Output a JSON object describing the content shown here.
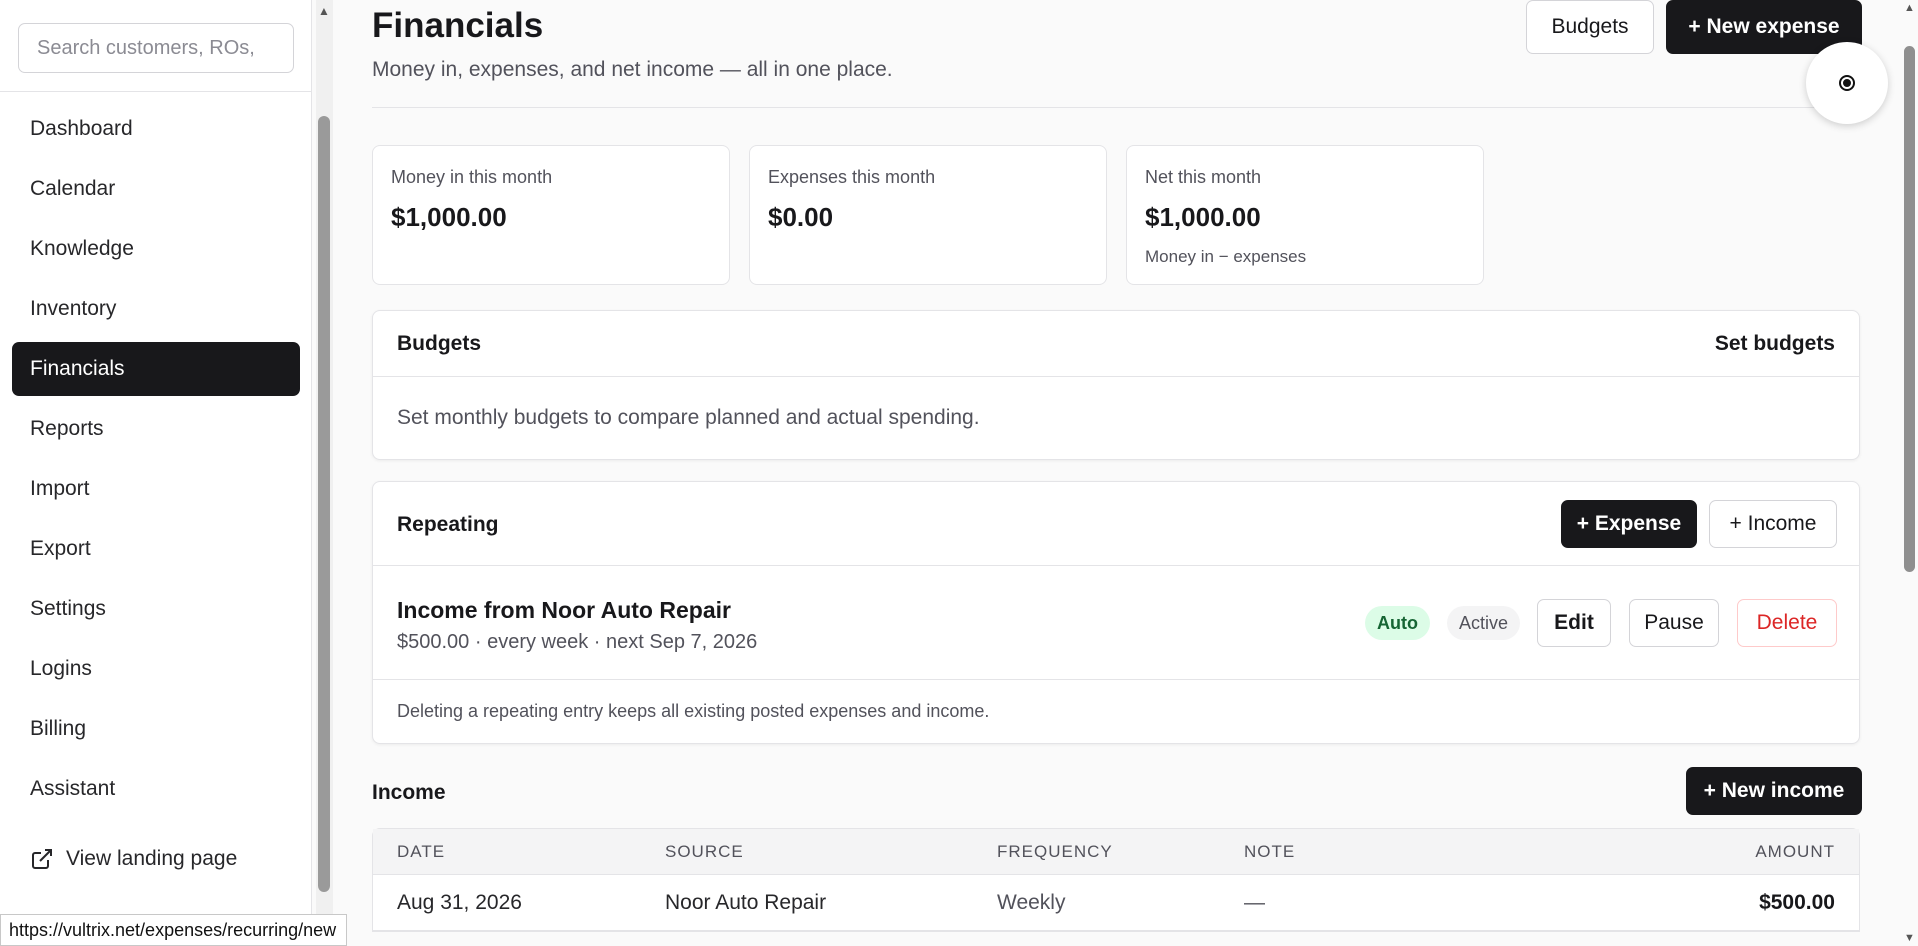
{
  "sidebar": {
    "search_placeholder": "Search customers, ROs,",
    "items": [
      {
        "label": "Dashboard"
      },
      {
        "label": "Calendar"
      },
      {
        "label": "Knowledge"
      },
      {
        "label": "Inventory"
      },
      {
        "label": "Financials",
        "active": true
      },
      {
        "label": "Reports"
      },
      {
        "label": "Import"
      },
      {
        "label": "Export"
      },
      {
        "label": "Settings"
      },
      {
        "label": "Logins"
      },
      {
        "label": "Billing"
      },
      {
        "label": "Assistant"
      }
    ],
    "landing_link": "View landing page"
  },
  "status_url": "https://vultrix.net/expenses/recurring/new",
  "header": {
    "title": "Financials",
    "subtitle": "Money in, expenses, and net income — all in one place.",
    "budgets_button": "Budgets",
    "new_expense_button": "+ New expense"
  },
  "stats": [
    {
      "label": "Money in this month",
      "value": "$1,000.00"
    },
    {
      "label": "Expenses this month",
      "value": "$0.00"
    },
    {
      "label": "Net this month",
      "value": "$1,000.00",
      "note": "Money in − expenses"
    }
  ],
  "budgets": {
    "title": "Budgets",
    "action": "Set budgets",
    "message": "Set monthly budgets to compare planned and actual spending."
  },
  "repeating": {
    "title": "Repeating",
    "add_expense": "+ Expense",
    "add_income": "+ Income",
    "entry": {
      "name": "Income from Noor Auto Repair",
      "meta": "$500.00 · every week · next Sep 7, 2026",
      "badge_auto": "Auto",
      "badge_status": "Active",
      "edit": "Edit",
      "pause": "Pause",
      "delete": "Delete"
    },
    "footnote": "Deleting a repeating entry keeps all existing posted expenses and income."
  },
  "income": {
    "title": "Income",
    "new_button": "+ New income",
    "columns": {
      "date": "DATE",
      "source": "SOURCE",
      "frequency": "FREQUENCY",
      "note": "NOTE",
      "amount": "AMOUNT"
    },
    "rows": [
      {
        "date": "Aug 31, 2026",
        "source": "Noor Auto Repair",
        "frequency": "Weekly",
        "note": "—",
        "amount": "$500.00"
      }
    ]
  },
  "colors": {
    "accent": "#18181b",
    "success_bg": "#dcfce7",
    "danger": "#dc2626"
  }
}
